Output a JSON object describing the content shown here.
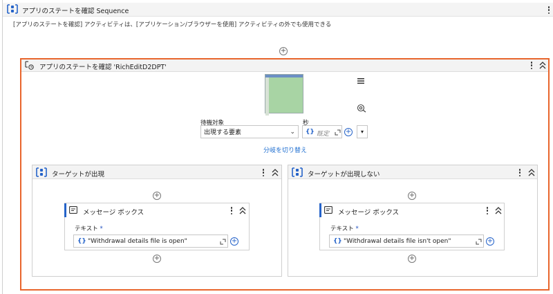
{
  "sequence": {
    "title": "アプリのステートを確認 Sequence",
    "note": "[アプリのステートを確認] アクティビティは、[アプリケーション/ブラウザーを使用] アクティビティの外でも使用できる"
  },
  "check_app_state": {
    "title": "アプリのステートを確認 'RichEditD2DPT'",
    "wait_for_label": "待機対象",
    "wait_for_value": "出現する要素",
    "seconds_label": "秒",
    "seconds_placeholder": "既定",
    "switch_branches_label": "分岐を切り替え"
  },
  "branches": {
    "left": {
      "title": "ターゲットが出現",
      "message_box": {
        "title": "メッセージ ボックス",
        "text_label": "テキスト",
        "required_mark": "*",
        "text_value": "\"Withdrawal details file is open\""
      }
    },
    "right": {
      "title": "ターゲットが出現しない",
      "message_box": {
        "title": "メッセージ ボックス",
        "text_label": "テキスト",
        "required_mark": "*",
        "text_value": "\"Withdrawal details file isn't open\""
      }
    }
  },
  "expression_brace": "{}",
  "colors": {
    "accent": "#e8652c",
    "link": "#1f6fd1",
    "brand_blue": "#2563c9"
  }
}
